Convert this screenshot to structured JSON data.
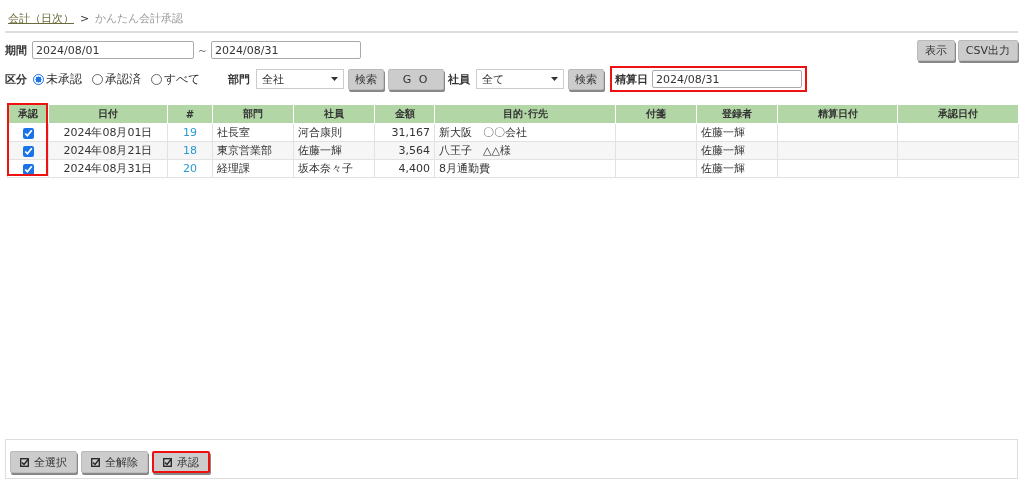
{
  "breadcrumb": {
    "link": "会計（日次）",
    "separator": ">",
    "current": "かんたん会計承認"
  },
  "period": {
    "label": "期間",
    "from": "2024/08/01",
    "tilde": "～",
    "to": "2024/08/31"
  },
  "top_buttons": [
    "表示",
    "CSV出力"
  ],
  "category": {
    "label": "区分",
    "options": [
      {
        "label": "未承認",
        "selected": true
      },
      {
        "label": "承認済",
        "selected": false
      },
      {
        "label": "すべて",
        "selected": false
      }
    ]
  },
  "department": {
    "label": "部門",
    "value": "全社",
    "search": "検索",
    "go": "G O"
  },
  "employee": {
    "label": "社員",
    "value": "全て",
    "search": "検索"
  },
  "settlement": {
    "label": "精算日",
    "value": "2024/08/31",
    "highlighted": true
  },
  "table": {
    "columns": [
      "承認",
      "日付",
      "#",
      "部門",
      "社員",
      "金額",
      "目的･行先",
      "付箋",
      "登録者",
      "精算日付",
      "承認日付"
    ],
    "approve_highlighted": true,
    "rows": [
      {
        "checked": true,
        "date": "2024年08月01日",
        "no": "19",
        "dept": "社長室",
        "employee": "河合康則",
        "amount": "31,167",
        "purpose": "新大阪　〇〇会社",
        "registrant": "佐藤一輝"
      },
      {
        "checked": true,
        "date": "2024年08月21日",
        "no": "18",
        "dept": "東京営業部",
        "employee": "佐藤一輝",
        "amount": "3,564",
        "purpose": "八王子　△△様",
        "registrant": "佐藤一輝"
      },
      {
        "checked": true,
        "date": "2024年08月31日",
        "no": "20",
        "dept": "経理課",
        "employee": "坂本奈々子",
        "amount": "4,400",
        "purpose": "8月通勤費",
        "registrant": "佐藤一輝"
      }
    ]
  },
  "footer_buttons": [
    {
      "label": "全選択",
      "highlighted": false
    },
    {
      "label": "全解除",
      "highlighted": false
    },
    {
      "label": "承認",
      "highlighted": true
    }
  ]
}
